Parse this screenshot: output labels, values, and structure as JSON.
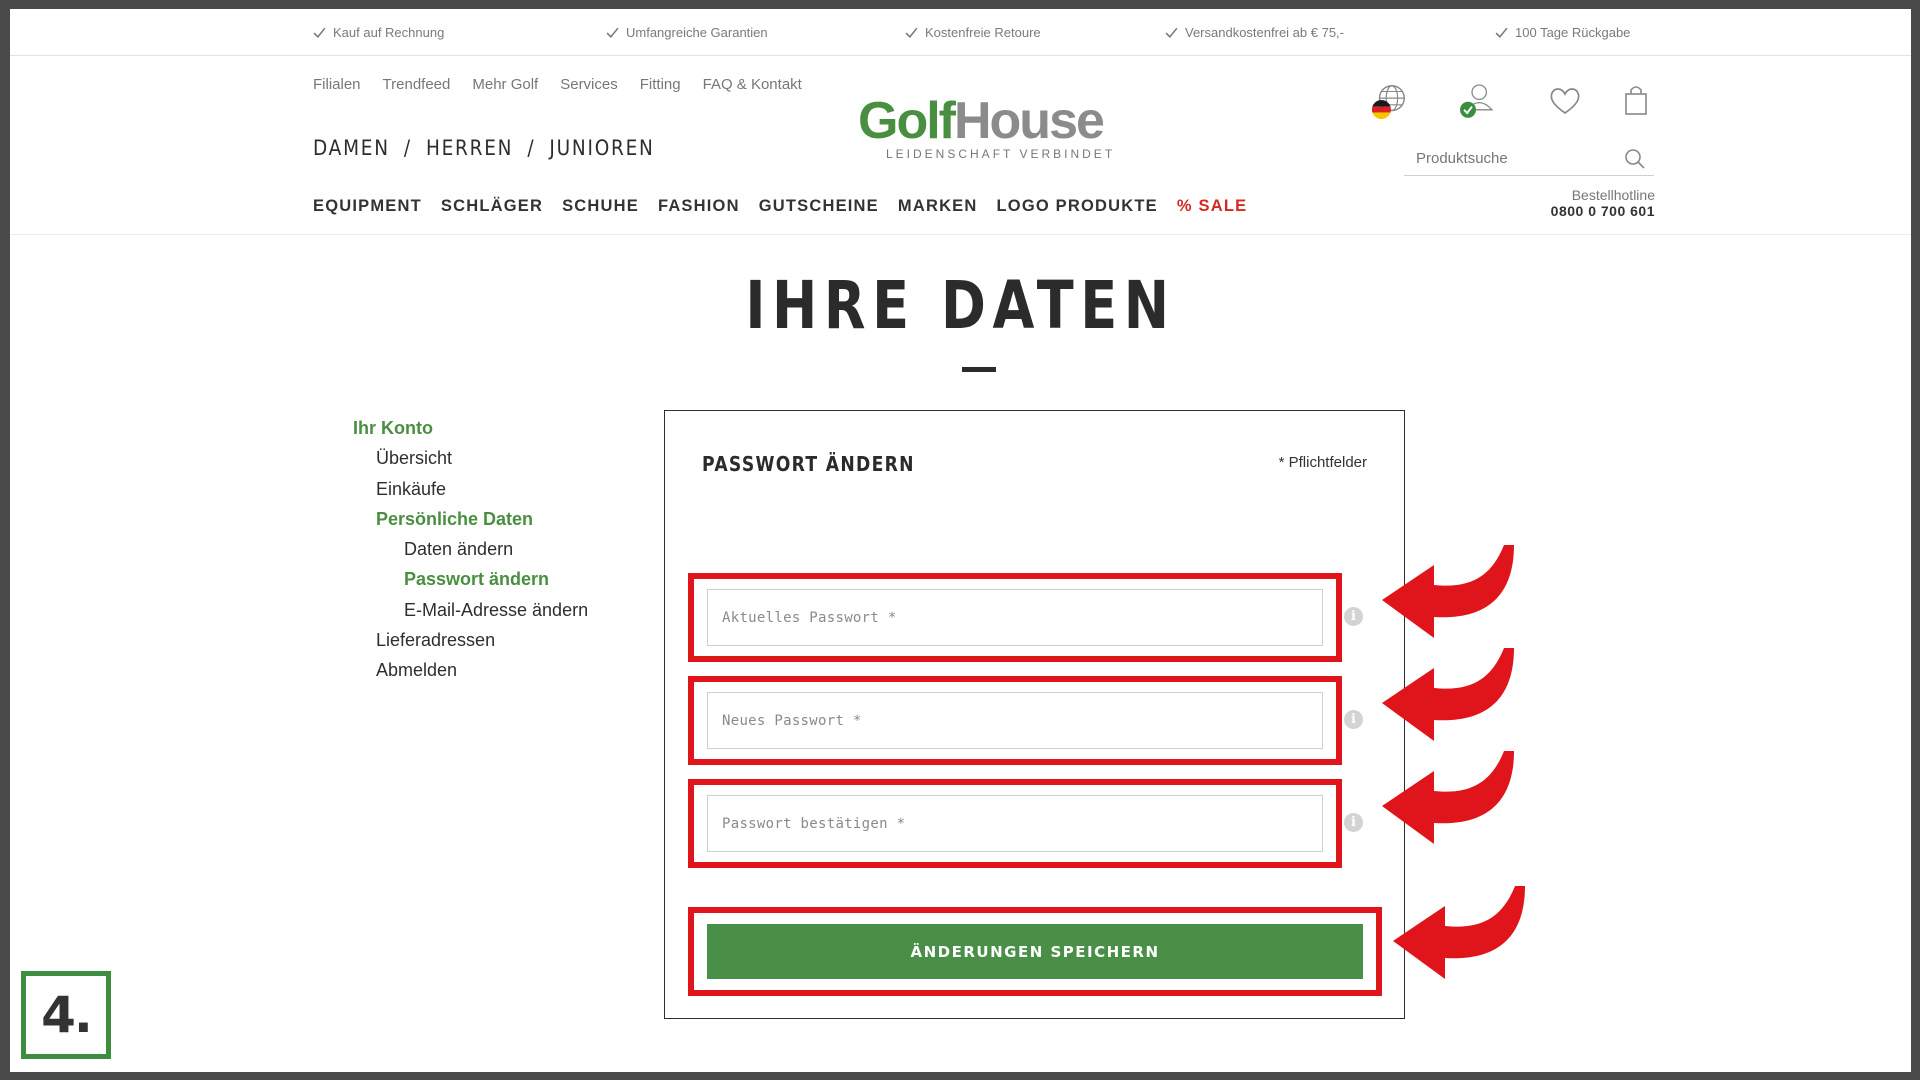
{
  "usp_bar": [
    {
      "text": "Kauf auf Rechnung",
      "icon": "check-icon"
    },
    {
      "text": "Umfangreiche Garantien",
      "icon": "check-icon"
    },
    {
      "text": "Kostenfreie Retoure",
      "icon": "check-icon"
    },
    {
      "text": "Versandkostenfrei ab € 75,-",
      "icon": "check-icon"
    },
    {
      "text": "100 Tage Rückgabe",
      "icon": "check-icon"
    }
  ],
  "meta_nav": [
    "Filialen",
    "Trendfeed",
    "Mehr Golf",
    "Services",
    "Fitting",
    "FAQ & Kontakt"
  ],
  "gender_nav": [
    "DAMEN",
    "/",
    "HERREN",
    "/",
    "JUNIOREN"
  ],
  "logo": {
    "word1": "Golf",
    "word2": "House",
    "tagline": "LEIDENSCHAFT VERBINDET"
  },
  "header_icons": [
    "globe-icon",
    "user-icon",
    "heart-icon",
    "shopping-bag-icon"
  ],
  "search": {
    "placeholder": "Produktsuche",
    "icon": "search-icon"
  },
  "main_nav": [
    "EQUIPMENT",
    "SCHLÄGER",
    "SCHUHE",
    "FASHION",
    "GUTSCHEINE",
    "MARKEN",
    "LOGO PRODUKTE",
    "% SALE"
  ],
  "hotline": {
    "label": "Bestellhotline",
    "number": "0800 0 700 601"
  },
  "page_title": "IHRE DATEN",
  "sidebar": [
    {
      "label": "Ihr Konto",
      "active": true
    },
    {
      "label": "Übersicht",
      "active": false
    },
    {
      "label": "Einkäufe",
      "active": false
    },
    {
      "label": "Persönliche Daten",
      "active": true
    },
    {
      "label": "Daten ändern",
      "active": false
    },
    {
      "label": "Passwort ändern",
      "active": true
    },
    {
      "label": "E-Mail-Adresse ändern",
      "active": false
    },
    {
      "label": "Lieferadressen",
      "active": false
    },
    {
      "label": "Abmelden",
      "active": false
    }
  ],
  "form": {
    "title": "PASSWORT ÄNDERN",
    "required_note": "* Pflichtfelder",
    "fields": [
      {
        "placeholder": "Aktuelles Passwort *",
        "value": ""
      },
      {
        "placeholder": "Neues Passwort *",
        "value": ""
      },
      {
        "placeholder": "Passwort bestätigen *",
        "value": ""
      }
    ],
    "info_icon": "i",
    "submit_label": "ÄNDERUNGEN SPEICHERN"
  },
  "annotation": {
    "step": "4.",
    "highlight_color": "#e0141b",
    "arrow_icon": "curved-arrow-icon"
  },
  "colors": {
    "brand_green": "#4a8f41",
    "sale_red": "#d42a22",
    "button_green": "#4a8f48"
  }
}
